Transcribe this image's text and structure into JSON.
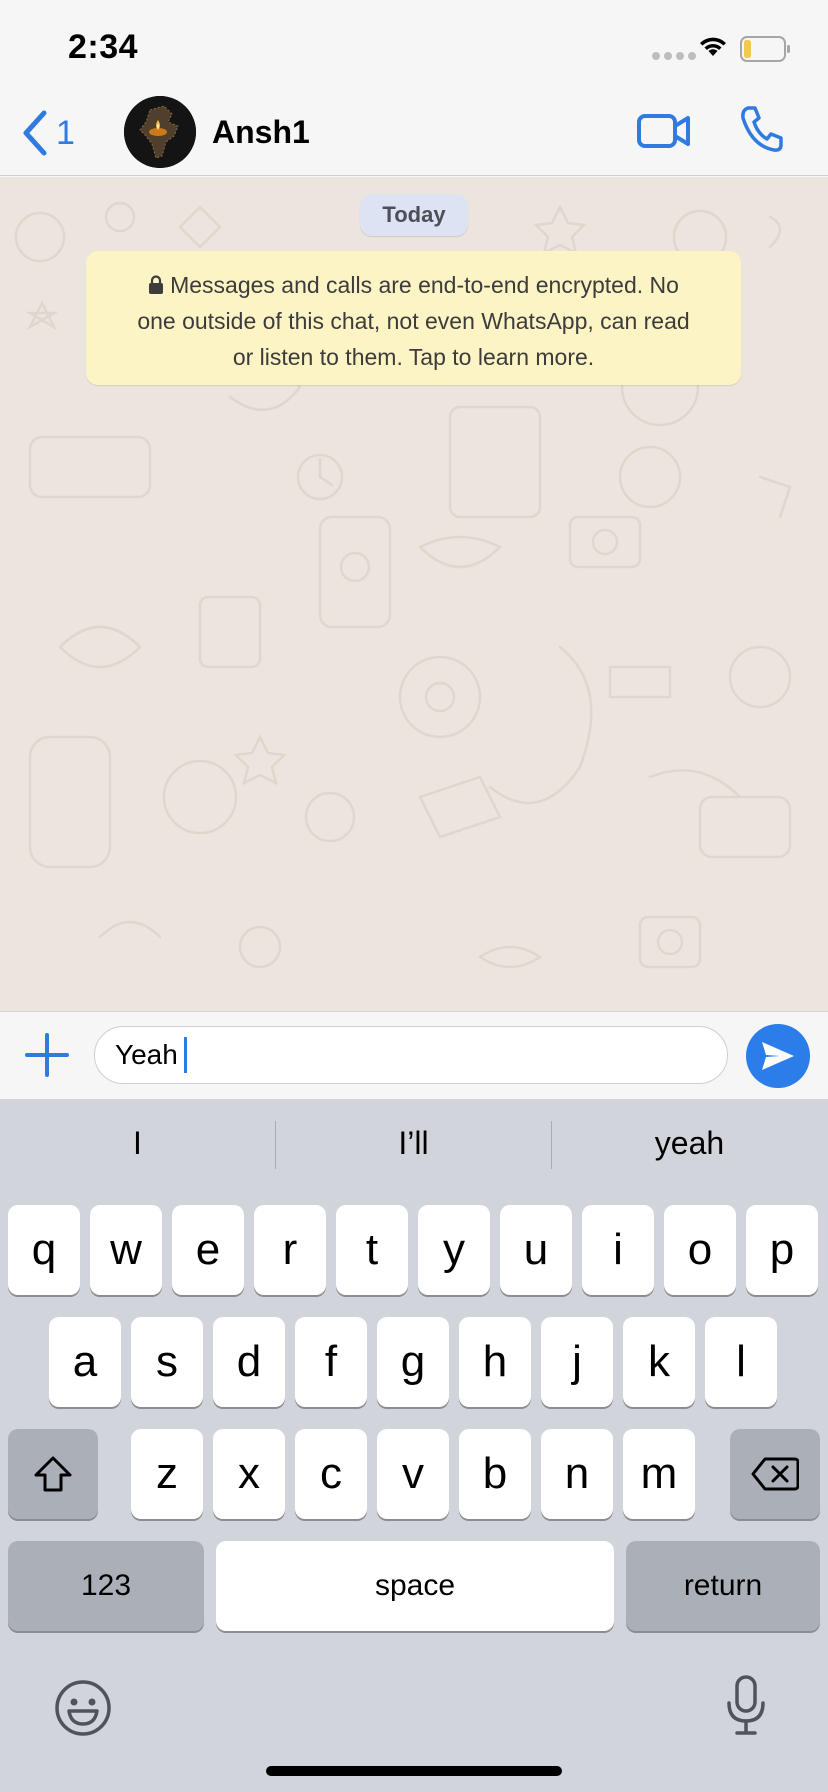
{
  "status_bar": {
    "time": "2:34",
    "wifi_icon": "wifi-icon",
    "battery_icon": "battery-low-icon",
    "battery_color": "#f2c94c"
  },
  "header": {
    "back_count": "1",
    "contact_name": "Ansh1",
    "video_icon": "video-camera-icon",
    "call_icon": "phone-icon",
    "accent_color": "#2f7be0"
  },
  "chat": {
    "date_label": "Today",
    "encryption_notice": "Messages and calls are end-to-end encrypted. No one outside of this chat, not even WhatsApp, can read or listen to them. Tap to learn more.",
    "encryption_line_1": "Messages and calls are end-to-end encrypted. No",
    "encryption_line_2": "one outside of this chat, not even WhatsApp, can read",
    "encryption_line_3": "or listen to them. Tap to learn more."
  },
  "composer": {
    "message_text": "Yeah",
    "send_color": "#2b7de9"
  },
  "keyboard": {
    "suggestions": [
      "I",
      "I’ll",
      "yeah"
    ],
    "row1": [
      "q",
      "w",
      "e",
      "r",
      "t",
      "y",
      "u",
      "i",
      "o",
      "p"
    ],
    "row2": [
      "a",
      "s",
      "d",
      "f",
      "g",
      "h",
      "j",
      "k",
      "l"
    ],
    "row3": [
      "z",
      "x",
      "c",
      "v",
      "b",
      "n",
      "m"
    ],
    "numbers_label": "123",
    "space_label": "space",
    "return_label": "return"
  }
}
